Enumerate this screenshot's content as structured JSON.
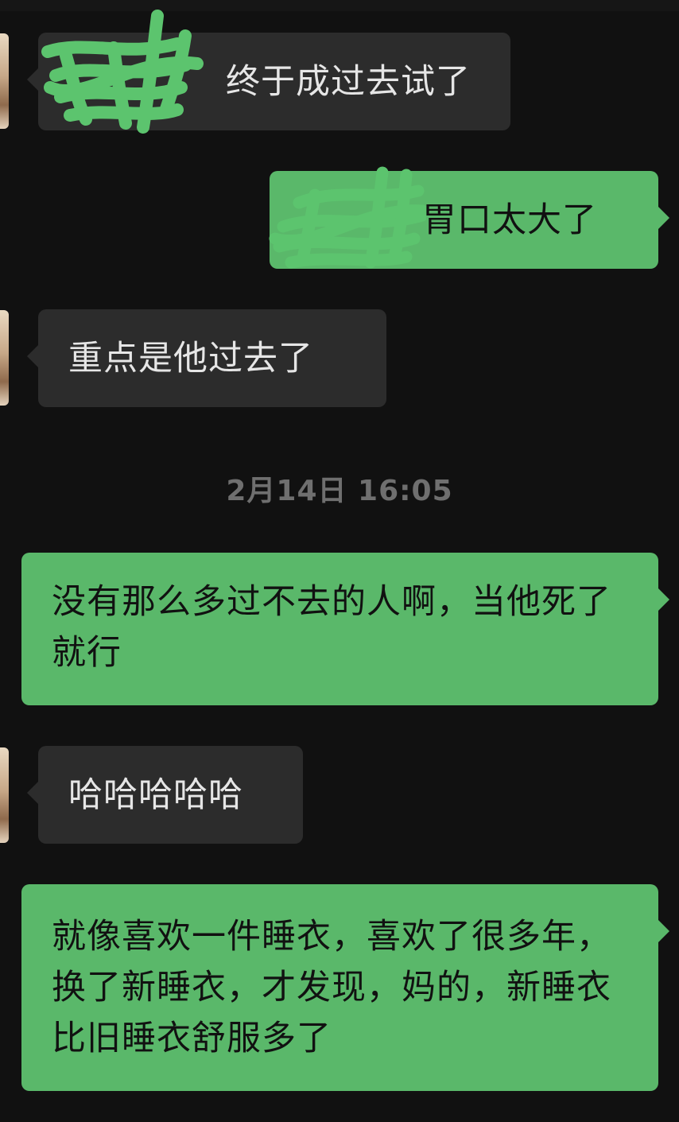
{
  "timestamp": "2月14日 16:05",
  "messages": [
    {
      "direction": "incoming",
      "text": "终于成过去试了",
      "redacted_prefix": true
    },
    {
      "direction": "outgoing",
      "text": "胃口太大了",
      "redacted_prefix": true
    },
    {
      "direction": "incoming",
      "text": "重点是他过去了"
    },
    {
      "direction": "outgoing",
      "text": "没有那么多过不去的人啊，当他死了就行"
    },
    {
      "direction": "incoming",
      "text": "哈哈哈哈哈"
    },
    {
      "direction": "outgoing",
      "text": "就像喜欢一件睡衣，喜欢了很多年，换了新睡衣，才发现，妈的，新睡衣比旧睡衣舒服多了"
    }
  ],
  "colors": {
    "background": "#111111",
    "incoming_bubble": "#2c2c2c",
    "outgoing_bubble": "#5ab86a",
    "redaction_scribble": "#5cc46e"
  }
}
